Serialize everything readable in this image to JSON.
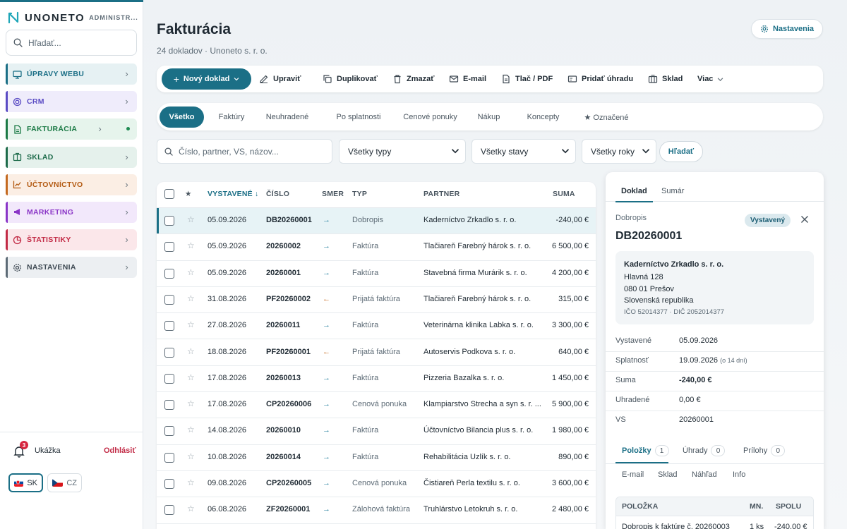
{
  "brand": {
    "name": "UNONETO",
    "sub": "ADMINISTR..."
  },
  "sidebar": {
    "search_placeholder": "Hľadať...",
    "items": [
      {
        "label": "ÚPRAVY WEBU",
        "icon": "monitor-icon"
      },
      {
        "label": "CRM",
        "icon": "target-icon"
      },
      {
        "label": "FAKTURÁCIA",
        "icon": "invoice-icon"
      },
      {
        "label": "SKLAD",
        "icon": "warehouse-icon"
      },
      {
        "label": "ÚČTOVNÍCTVO",
        "icon": "chart-line-icon"
      },
      {
        "label": "MARKETING",
        "icon": "megaphone-icon"
      },
      {
        "label": "ŠTATISTIKY",
        "icon": "pie-chart-icon"
      },
      {
        "label": "NASTAVENIA",
        "icon": "gear-icon"
      }
    ],
    "notifications": "3",
    "user": "Ukážka",
    "logout": "Odhlásiť",
    "langs": [
      "SK",
      "CZ"
    ]
  },
  "header": {
    "title": "Fakturácia",
    "subtitle": "24 dokladov · Unoneto s. r. o.",
    "settings": "Nastavenia"
  },
  "toolbar": {
    "new": "Nový doklad",
    "edit": "Upraviť",
    "duplicate": "Duplikovať",
    "delete": "Zmazať",
    "email": "E-mail",
    "print": "Tlač / PDF",
    "payment": "Pridať úhradu",
    "stock": "Sklad",
    "more": "Viac"
  },
  "tabs": [
    "Všetko",
    "Faktúry",
    "Neuhradené",
    "Po splatnosti",
    "Cenové ponuky",
    "Nákup",
    "Koncepty",
    "★ Označené"
  ],
  "filters": {
    "search_placeholder": "Číslo, partner, VS, názov...",
    "types": "Všetky typy",
    "states": "Všetky stavy",
    "years": "Všetky roky",
    "search_button": "Hľadať"
  },
  "table": {
    "headers": {
      "star": "★",
      "date": "VYSTAVENÉ ↓",
      "number": "ČÍSLO",
      "direction": "SMER",
      "type": "TYP",
      "partner": "PARTNER",
      "amount": "SUMA"
    },
    "rows": [
      {
        "date": "05.09.2026",
        "number": "DB20260001",
        "dir": "→",
        "type": "Dobropis",
        "partner": "Kaderníctvo Zrkadlo s. r. o.",
        "amount": "-240,00 €"
      },
      {
        "date": "05.09.2026",
        "number": "20260002",
        "dir": "→",
        "type": "Faktúra",
        "partner": "Tlačiareň Farebný hárok s. r. o.",
        "amount": "6 500,00 €"
      },
      {
        "date": "05.09.2026",
        "number": "20260001",
        "dir": "→",
        "type": "Faktúra",
        "partner": "Stavebná firma Murárik s. r. o.",
        "amount": "4 200,00 €"
      },
      {
        "date": "31.08.2026",
        "number": "PF20260002",
        "dir": "←",
        "type": "Prijatá faktúra",
        "partner": "Tlačiareň Farebný hárok s. r. o.",
        "amount": "315,00 €"
      },
      {
        "date": "27.08.2026",
        "number": "20260011",
        "dir": "→",
        "type": "Faktúra",
        "partner": "Veterinárna klinika Labka s. r. o.",
        "amount": "3 300,00 €"
      },
      {
        "date": "18.08.2026",
        "number": "PF20260001",
        "dir": "←",
        "type": "Prijatá faktúra",
        "partner": "Autoservis Podkova s. r. o.",
        "amount": "640,00 €"
      },
      {
        "date": "17.08.2026",
        "number": "20260013",
        "dir": "→",
        "type": "Faktúra",
        "partner": "Pizzeria Bazalka s. r. o.",
        "amount": "1 450,00 €"
      },
      {
        "date": "17.08.2026",
        "number": "CP20260006",
        "dir": "→",
        "type": "Cenová ponuka",
        "partner": "Klampiarstvo Strecha a syn s. r. ...",
        "amount": "5 900,00 €"
      },
      {
        "date": "14.08.2026",
        "number": "20260010",
        "dir": "→",
        "type": "Faktúra",
        "partner": "Účtovníctvo Bilancia plus s. r. o.",
        "amount": "1 980,00 €"
      },
      {
        "date": "10.08.2026",
        "number": "20260014",
        "dir": "→",
        "type": "Faktúra",
        "partner": "Rehabilitácia Uzlík s. r. o.",
        "amount": "890,00 €"
      },
      {
        "date": "09.08.2026",
        "number": "CP20260005",
        "dir": "→",
        "type": "Cenová ponuka",
        "partner": "Čistiareň Perla textilu s. r. o.",
        "amount": "3 600,00 €"
      },
      {
        "date": "06.08.2026",
        "number": "ZF20260001",
        "dir": "→",
        "type": "Zálohová faktúra",
        "partner": "Truhlárstvo Letokruh s. r. o.",
        "amount": "2 480,00 €"
      }
    ]
  },
  "detail": {
    "tabs": [
      "Doklad",
      "Sumár"
    ],
    "kind": "Dobropis",
    "status": "Vystavený",
    "number": "DB20260001",
    "partner": {
      "name": "Kaderníctvo Zrkadlo s. r. o.",
      "street": "Hlavná 128",
      "city": "080 01 Prešov",
      "country": "Slovenská republika",
      "ids": "IČO 52014377 · DIČ 2052014377"
    },
    "fields": {
      "issued_label": "Vystavené",
      "issued": "05.09.2026",
      "due_label": "Splatnosť",
      "due": "19.09.2026",
      "due_note": "(o 14 dní)",
      "sum_label": "Suma",
      "sum": "-240,00 €",
      "paid_label": "Uhradené",
      "paid": "0,00 €",
      "vs_label": "VS",
      "vs": "20260001"
    },
    "subtabs": [
      {
        "label": "Položky",
        "count": "1"
      },
      {
        "label": "Úhrady",
        "count": "0"
      },
      {
        "label": "Prílohy",
        "count": "0"
      }
    ],
    "subtabs2": [
      "E-mail",
      "Sklad",
      "Náhľad",
      "Info"
    ],
    "items_headers": {
      "name": "POLOŽKA",
      "qty": "MN.",
      "total": "SPOLU"
    },
    "items": [
      {
        "name": "Dobropis k faktúre č. 20260003",
        "qty": "1 ks",
        "total": "-240,00 €"
      }
    ]
  },
  "colors": {
    "accent": "#1b6f86",
    "danger": "#c22a45"
  }
}
